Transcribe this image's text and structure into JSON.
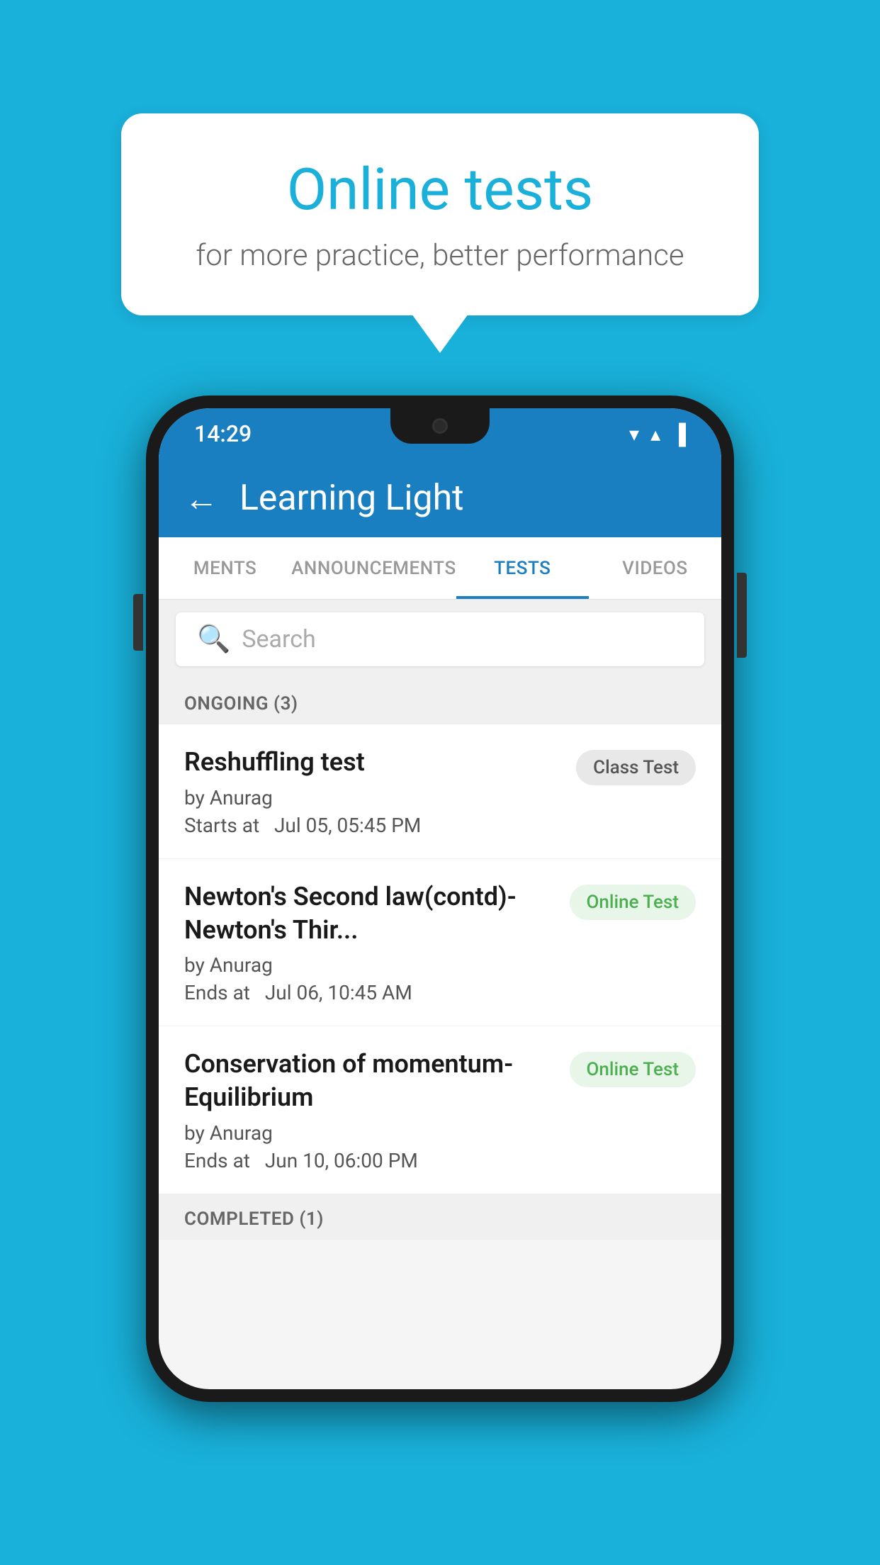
{
  "background_color": "#19b0d9",
  "speech_bubble": {
    "title": "Online tests",
    "subtitle": "for more practice, better performance"
  },
  "phone": {
    "status_bar": {
      "time": "14:29",
      "wifi_icon": "▼",
      "signal_icon": "▲",
      "battery_icon": "▐"
    },
    "app_bar": {
      "back_label": "←",
      "title": "Learning Light"
    },
    "tabs": [
      {
        "label": "MENTS",
        "active": false
      },
      {
        "label": "ANNOUNCEMENTS",
        "active": false
      },
      {
        "label": "TESTS",
        "active": true
      },
      {
        "label": "VIDEOS",
        "active": false
      }
    ],
    "search": {
      "placeholder": "Search"
    },
    "ongoing_section": {
      "label": "ONGOING (3)"
    },
    "tests": [
      {
        "name": "Reshuffling test",
        "author": "by Anurag",
        "time_label": "Starts at",
        "time": "Jul 05, 05:45 PM",
        "badge": "Class Test",
        "badge_type": "class"
      },
      {
        "name": "Newton's Second law(contd)-Newton's Thir...",
        "author": "by Anurag",
        "time_label": "Ends at",
        "time": "Jul 06, 10:45 AM",
        "badge": "Online Test",
        "badge_type": "online"
      },
      {
        "name": "Conservation of momentum-Equilibrium",
        "author": "by Anurag",
        "time_label": "Ends at",
        "time": "Jun 10, 06:00 PM",
        "badge": "Online Test",
        "badge_type": "online"
      }
    ],
    "completed_section": {
      "label": "COMPLETED (1)"
    }
  }
}
